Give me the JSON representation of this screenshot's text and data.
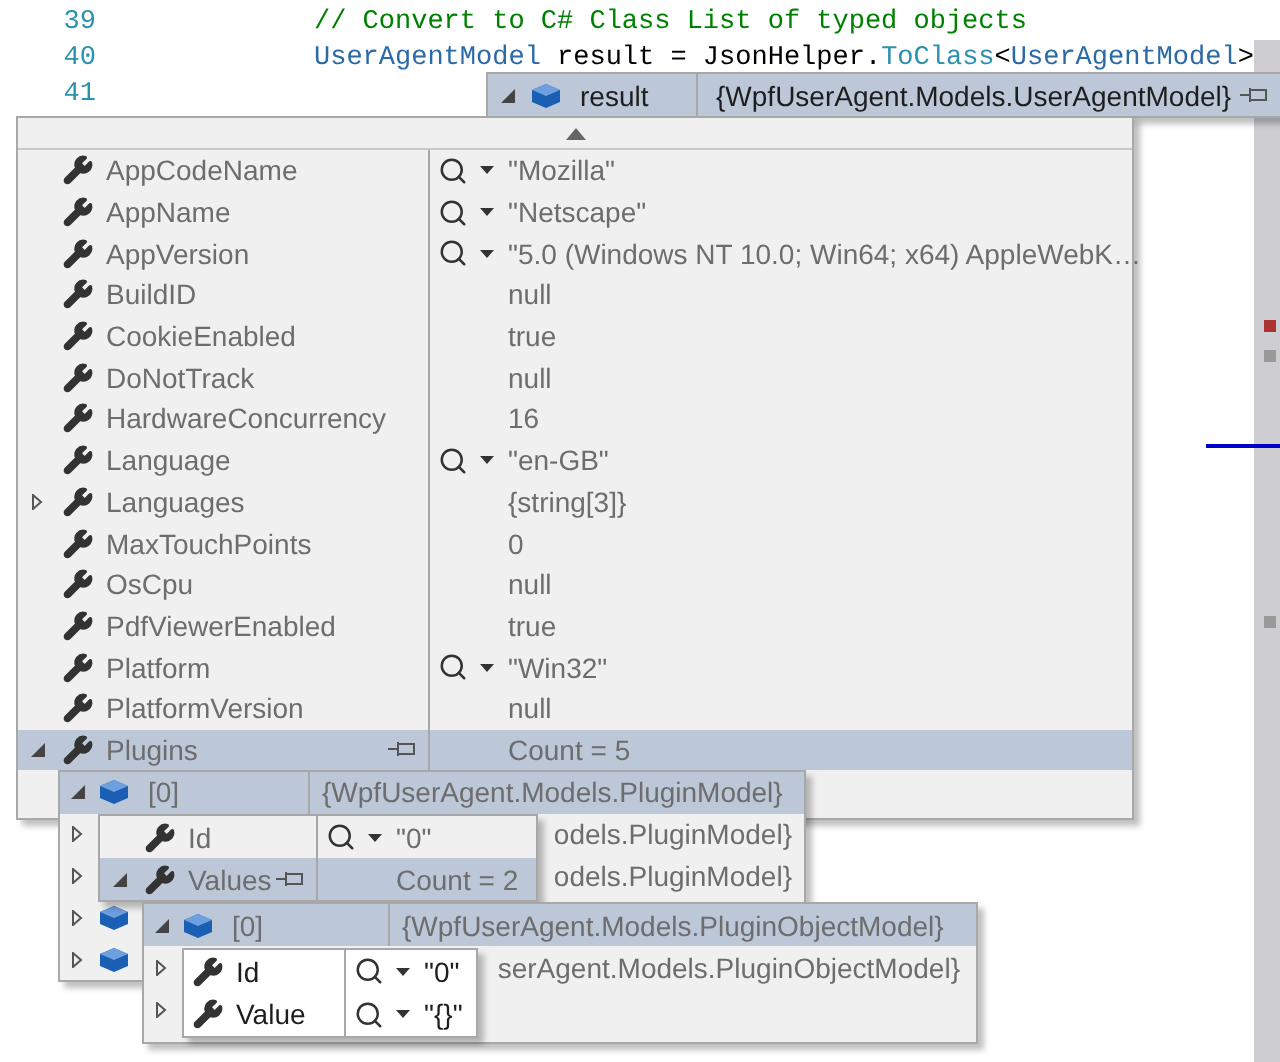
{
  "code_lines": [
    {
      "number": "39",
      "tokens": [
        {
          "kind": "comment",
          "text": "// Convert to C# Class List of typed objects"
        }
      ]
    },
    {
      "number": "40",
      "tokens": [
        {
          "kind": "type",
          "text": "UserAgentModel"
        },
        {
          "kind": "plain",
          "text": " result = JsonHelper."
        },
        {
          "kind": "method",
          "text": "ToClass"
        },
        {
          "kind": "plain",
          "text": "<"
        },
        {
          "kind": "type",
          "text": "UserAgentModel"
        },
        {
          "kind": "plain",
          "text": ">"
        }
      ]
    },
    {
      "number": "41"
    }
  ],
  "datatip": {
    "name": "result",
    "value": "{WpfUserAgent.Models.UserAgentModel}",
    "expanded": true,
    "selected": true
  },
  "members": [
    {
      "name": "AppCodeName",
      "value": "\"Mozilla\"",
      "inspect": true,
      "selected": false
    },
    {
      "name": "AppName",
      "value": "\"Netscape\"",
      "inspect": true,
      "selected": false
    },
    {
      "name": "AppVersion",
      "value": "\"5.0 (Windows NT 10.0; Win64; x64) AppleWebK…",
      "inspect": true,
      "selected": false
    },
    {
      "name": "BuildID",
      "value": "null",
      "inspect": false,
      "selected": false
    },
    {
      "name": "CookieEnabled",
      "value": "true",
      "inspect": false,
      "selected": false
    },
    {
      "name": "DoNotTrack",
      "value": "null",
      "inspect": false,
      "selected": false
    },
    {
      "name": "HardwareConcurrency",
      "value": "16",
      "inspect": false,
      "selected": false
    },
    {
      "name": "Language",
      "value": "\"en-GB\"",
      "inspect": true,
      "selected": false
    },
    {
      "name": "Languages",
      "value": "{string[3]}",
      "inspect": false,
      "expanded": false,
      "selected": false
    },
    {
      "name": "MaxTouchPoints",
      "value": "0",
      "inspect": false,
      "selected": false
    },
    {
      "name": "OsCpu",
      "value": "null",
      "inspect": false,
      "selected": false
    },
    {
      "name": "PdfViewerEnabled",
      "value": "true",
      "inspect": false,
      "selected": false
    },
    {
      "name": "Platform",
      "value": "\"Win32\"",
      "inspect": true,
      "selected": false
    },
    {
      "name": "PlatformVersion",
      "value": "null",
      "inspect": false,
      "selected": false
    },
    {
      "name": "Plugins",
      "value": "Count = 5",
      "inspect": false,
      "expanded": true,
      "selected": true
    }
  ],
  "plugins": [
    {
      "index": "[0]",
      "value": "{WpfUserAgent.Models.PluginModel}",
      "expanded": true,
      "selected": true
    },
    {
      "value": "odels.PluginModel}",
      "expanded": false,
      "selected": false
    },
    {
      "value": "odels.PluginModel}",
      "expanded": false,
      "selected": false
    },
    {
      "expanded": false,
      "selected": false
    },
    {
      "expanded": false,
      "selected": false
    }
  ],
  "plugin_members": [
    {
      "name": "Id",
      "value": "\"0\"",
      "inspect": true,
      "selected": false
    },
    {
      "name": "Values",
      "value": "Count = 2",
      "inspect": false,
      "expanded": true,
      "selected": true
    }
  ],
  "values": [
    {
      "index": "[0]",
      "value": "{WpfUserAgent.Models.PluginObjectModel}",
      "expanded": true,
      "selected": true
    },
    {
      "value": "serAgent.Models.PluginObjectModel}",
      "expanded": false,
      "selected": false
    },
    {
      "expanded": false,
      "selected": false
    }
  ],
  "value_members": [
    {
      "name": "Id",
      "value": "\"0\"",
      "inspect": true
    },
    {
      "name": "Value",
      "value": "\"{}\"",
      "inspect": true
    }
  ]
}
